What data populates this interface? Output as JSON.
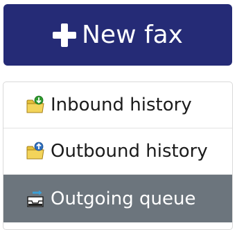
{
  "new_fax": {
    "label": "New fax",
    "icon": "plus-icon"
  },
  "menu": {
    "items": [
      {
        "label": "Inbound history",
        "icon": "folder-download-icon",
        "active": false
      },
      {
        "label": "Outbound history",
        "icon": "folder-upload-icon",
        "active": false
      },
      {
        "label": "Outgoing queue",
        "icon": "outbox-tray-icon",
        "active": true
      }
    ]
  },
  "colors": {
    "primary_button": "#252b76",
    "active_item": "#6c757d",
    "folder_yellow": "#e6c23a",
    "download_green": "#2e9a2e",
    "upload_blue": "#2f6fbf"
  }
}
